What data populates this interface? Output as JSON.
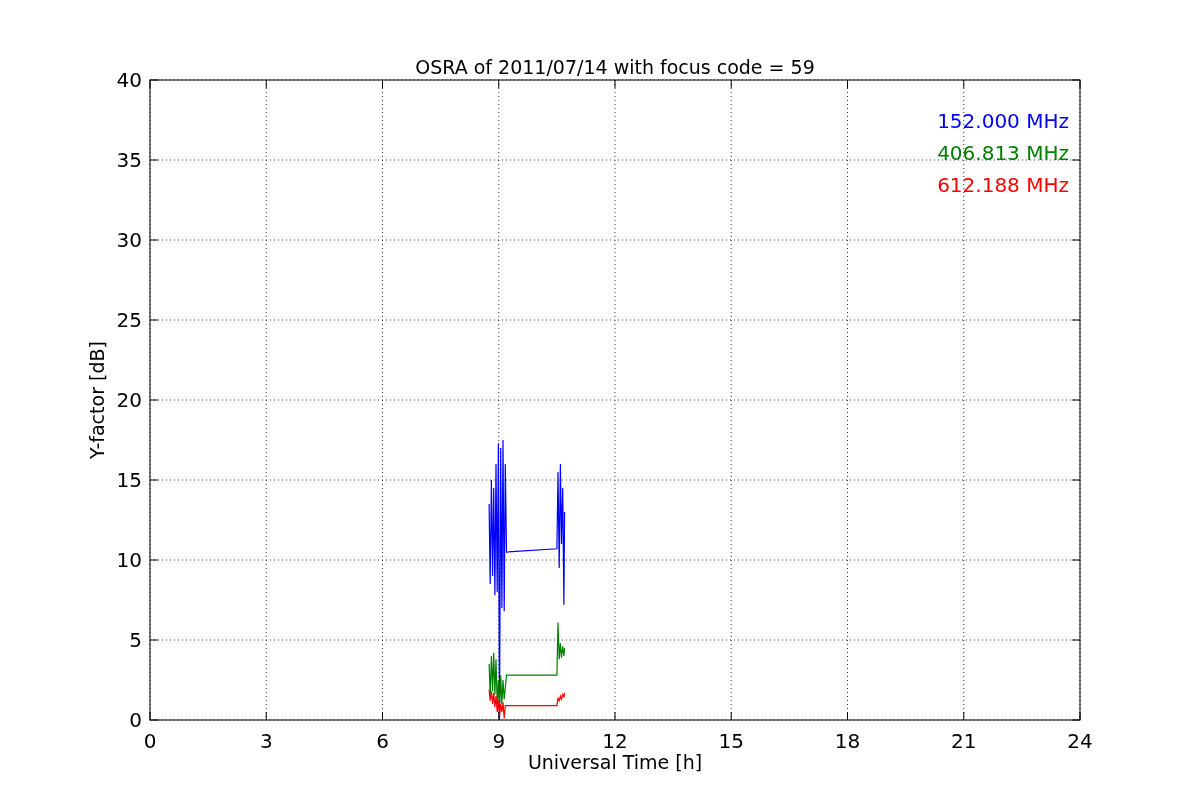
{
  "chart_data": {
    "type": "line",
    "title": "OSRA of 2011/07/14 with focus code = 59",
    "xlabel": "Universal Time [h]",
    "ylabel": "Y-factor [dB]",
    "x": [
      8.75,
      8.78,
      8.81,
      8.84,
      8.87,
      8.9,
      8.93,
      8.96,
      8.99,
      9.02,
      9.05,
      9.08,
      9.11,
      9.14,
      9.17,
      9.2,
      10.5,
      10.53,
      10.56,
      10.59,
      10.62,
      10.65,
      10.68,
      10.7
    ],
    "series": [
      {
        "name": "152.000 MHz",
        "color": "#0000ff",
        "values": [
          13.5,
          8.5,
          15,
          9,
          14.5,
          7.8,
          16,
          8,
          17.3,
          0,
          17,
          7,
          17.5,
          6.8,
          16,
          10.5,
          10.7,
          15.5,
          9.5,
          16,
          11,
          14.5,
          7.2,
          13
        ]
      },
      {
        "name": "406.813 MHz",
        "color": "#008000",
        "values": [
          3.5,
          1.5,
          4,
          1.8,
          4.2,
          1.6,
          3.8,
          1,
          2.5,
          0.5,
          2.8,
          1,
          2.5,
          1.3,
          2,
          2.8,
          2.8,
          6.1,
          3.8,
          4.8,
          3.9,
          4.6,
          4,
          4.5
        ]
      },
      {
        "name": "612.188 MHz",
        "color": "#ff0000",
        "values": [
          1.9,
          1.2,
          1.8,
          1,
          1.7,
          0.8,
          1.5,
          0.5,
          1.2,
          0.2,
          1,
          0.5,
          1.1,
          0.1,
          0.9,
          0.9,
          0.9,
          1.4,
          1.2,
          1.5,
          1.3,
          1.6,
          1.4,
          1.7
        ]
      }
    ],
    "grid": true,
    "xlim": [
      0,
      24
    ],
    "ylim": [
      0,
      40
    ],
    "xticks": [
      0,
      3,
      6,
      9,
      12,
      15,
      18,
      21,
      24
    ],
    "yticks": [
      0,
      5,
      10,
      15,
      20,
      25,
      30,
      35,
      40
    ]
  }
}
